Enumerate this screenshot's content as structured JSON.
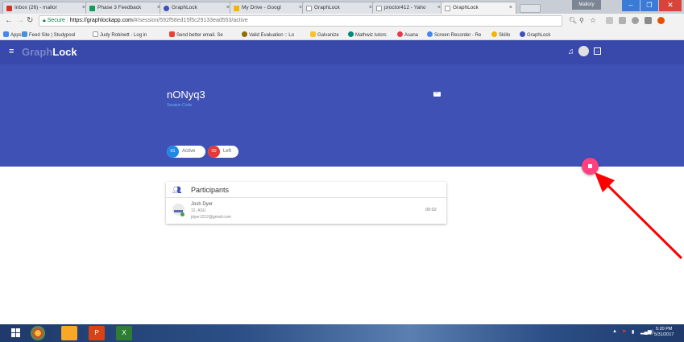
{
  "browser": {
    "tabs": [
      {
        "label": "Inbox (26) - mallor",
        "icon_color": "#d93025"
      },
      {
        "label": "Phase 3 Feedback",
        "icon_color": "#0f9d58"
      },
      {
        "label": "GraphLock",
        "icon_color": "#3f51b5"
      },
      {
        "label": "My Drive - Googl",
        "icon_color": "#f4b400"
      },
      {
        "label": "GraphLock",
        "icon_color": "#9e9e9e"
      },
      {
        "label": "proctor412 - Yaho",
        "icon_color": "#6001d2"
      },
      {
        "label": "GraphLock",
        "icon_color": "#9e9e9e"
      }
    ],
    "window_user": "Mallory",
    "url_secure": "Secure",
    "url_host": "https://graphlockapp.com",
    "url_path": "/#/session/592f58ed15f5c29133ead553/active",
    "bookmarks": [
      {
        "label": "Apps",
        "color": "#4285f4"
      },
      {
        "label": "Feed Site | Studypool",
        "color": "#4a90d9"
      },
      {
        "label": "Judy Robinett - Log in",
        "color": "#9e9e9e"
      },
      {
        "label": "Send better email. Se",
        "color": "#ea4335"
      },
      {
        "label": "Valid Evaluation :: Lo",
        "color": "#8d6e00"
      },
      {
        "label": "Galvanize",
        "color": "#fbc02d"
      },
      {
        "label": "Mathwiz tutors",
        "color": "#00897b"
      },
      {
        "label": "Asana",
        "color": "#e8384f"
      },
      {
        "label": "Screen Recorder - Re",
        "color": "#4285f4"
      },
      {
        "label": "Skillo",
        "color": "#f4b400"
      },
      {
        "label": "GraphLock",
        "color": "#3f51b5"
      }
    ]
  },
  "app": {
    "logo_part1": "Graph",
    "logo_part2": "Lock",
    "session_code": "nONyq3",
    "session_code_label": "Session Code",
    "active_count": "01",
    "active_label": "Active",
    "left_count": "00",
    "left_label": "Left",
    "participants_title": "Participants",
    "participant": {
      "name": "Josh Dyer",
      "info": "12, ASU",
      "email": "jdyer1212@gmail.com",
      "time": "00:02"
    }
  },
  "taskbar": {
    "clock_time": "5:20 PM",
    "clock_date": "5/31/2017"
  },
  "colors": {
    "primary": "#3f51b5",
    "primary_dark": "#3949ab",
    "accent": "#ff4081",
    "active_chip": "#1e88e5",
    "left_chip": "#e53935",
    "annotation_arrow": "#ff0000"
  }
}
